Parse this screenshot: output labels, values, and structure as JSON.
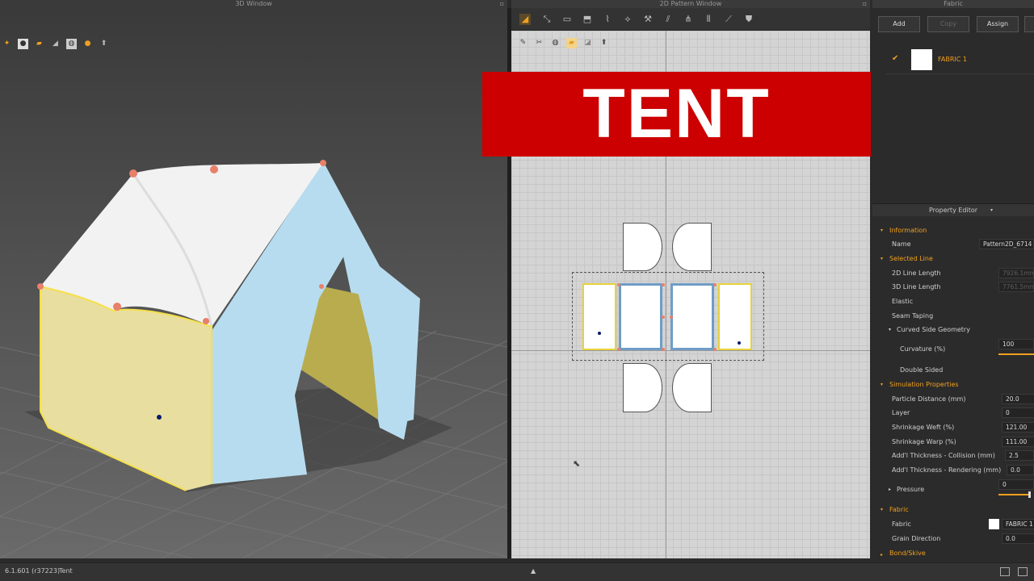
{
  "windows": {
    "view3d_title": "3D Window",
    "pattern_title": "2D Pattern Window",
    "fabric_title": "Fabric"
  },
  "toolbar3d": {
    "icons": [
      "move-pin-icon",
      "transform-icon",
      "arrange-icon",
      "fold-icon",
      "select-mesh-icon",
      "garment-icon",
      "avatar-icon",
      "grid-icon",
      "measure-icon",
      "tape-icon",
      "pin-icon",
      "line-icon",
      "pose-icon"
    ],
    "sub_icons": [
      "simulation-icon",
      "avatar-display-icon",
      "fabric-display-icon",
      "texture-icon",
      "render-icon",
      "record-icon",
      "export-icon"
    ]
  },
  "toolbar2d": {
    "icons": [
      "transform-pattern-icon",
      "edit-point-icon",
      "rectangle-icon",
      "polygon-icon",
      "internal-line-icon",
      "dart-icon",
      "fold-arrange-icon",
      "segment-sewing-icon",
      "free-sewing-icon",
      "check-sewing-icon",
      "trace-icon",
      "avatar-silhouette-icon"
    ],
    "sub_icons": [
      "pattern-display-icon",
      "scissors-icon",
      "texture-2d-icon",
      "fabric-2d-icon",
      "mirror-icon",
      "export-2d-icon"
    ]
  },
  "banner": {
    "text": "TENT"
  },
  "fabric_panel": {
    "buttons": {
      "add": "Add",
      "copy": "Copy",
      "assign": "Assign"
    },
    "items": [
      {
        "name": "FABRIC 1",
        "checked": true
      }
    ]
  },
  "property_editor": {
    "title": "Property Editor",
    "information": {
      "label": "Information",
      "name_label": "Name",
      "name_value": "Pattern2D_6714"
    },
    "selected_line": {
      "label": "Selected Line",
      "line2d_label": "2D Line Length",
      "line2d_value": "7926.1mm",
      "line3d_label": "3D Line Length",
      "line3d_value": "7761.5mm",
      "elastic_label": "Elastic",
      "seam_taping_label": "Seam Taping",
      "curved_label": "Curved Side Geometry",
      "curvature_label": "Curvature (%)",
      "curvature_value": "100",
      "curvature_fraction": 1.0,
      "double_sided_label": "Double Sided"
    },
    "simulation": {
      "label": "Simulation Properties",
      "rows": [
        {
          "label": "Particle Distance (mm)",
          "value": "20.0"
        },
        {
          "label": "Layer",
          "value": "0"
        },
        {
          "label": "Shrinkage Weft (%)",
          "value": "121.00"
        },
        {
          "label": "Shrinkage Warp (%)",
          "value": "111.00"
        },
        {
          "label": "Add'l Thickness - Collision (mm)",
          "value": "2.5"
        },
        {
          "label": "Add'l Thickness - Rendering (mm)",
          "value": "0.0"
        }
      ],
      "pressure_label": "Pressure",
      "pressure_value": "0",
      "pressure_fraction": 0.0
    },
    "fabric": {
      "label": "Fabric",
      "fabric_label": "Fabric",
      "fabric_value": "FABRIC 1",
      "grain_label": "Grain Direction",
      "grain_value": "0.0",
      "next_section": "Bond/Skive"
    }
  },
  "status": {
    "version": "6.1.601 (r37223)",
    "file": "Tent"
  },
  "colors": {
    "accent": "#f0a020",
    "banner": "#cc0000",
    "tent_roof": "#f2f2f2",
    "tent_side_blue": "#b7dcef",
    "tent_front_yellow": "#e8dea0",
    "seam_line": "#f5e04a",
    "pin": "#e8806a"
  }
}
